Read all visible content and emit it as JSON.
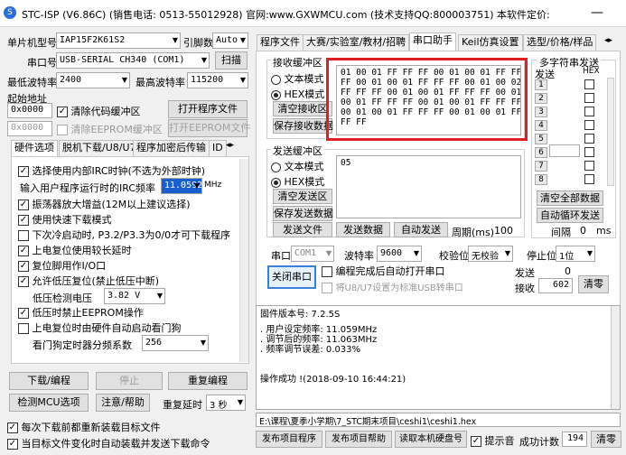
{
  "title": "STC-ISP (V6.86C) (销售电话: 0513-55012928) 官网:www.GXWMCU.com  (技术支持QQ:800003751) 本软件定价:",
  "left": {
    "mcu_model_label": "单片机型号",
    "mcu_model": "IAP15F2K61S2",
    "pin_label": "引脚数",
    "pin_value": "Auto",
    "port_label": "串口号",
    "port_value": "USB-SERIAL CH340 (COM1)",
    "scan_btn": "扫描",
    "min_baud_label": "最低波特率",
    "min_baud": "2400",
    "max_baud_label": "最高波特率",
    "max_baud": "115200",
    "start_addr_label": "起始地址",
    "addr1": "0x0000",
    "clear_code_label": "清除代码缓冲区",
    "open_prog_btn": "打开程序文件",
    "addr2": "0x0000",
    "clear_eeprom_label": "清除EEPROM缓冲区",
    "open_eeprom_btn": "打开EEPROM文件",
    "tabs": [
      "硬件选项",
      "脱机下载/U8/U7",
      "程序加密后传输",
      "ID"
    ],
    "opt_irc": "选择使用内部IRC时钟(不选为外部时钟)",
    "opt_freq_label": "输入用户程序运行时的IRC频率",
    "opt_freq_value": "11.0592",
    "opt_freq_unit": "MHz",
    "opt_amp": "振荡器放大增益(12M以上建议选择)",
    "opt_fast": "使用快速下载模式",
    "opt_cold": "下次冷启动时, P3.2/P3.3为0/0才可下载程序",
    "opt_reset_delay": "上电复位使用较长延时",
    "opt_reset_pin": "复位脚用作I/O口",
    "opt_lvr": "允许低压复位(禁止低压中断)",
    "opt_lv_label": "低压检测电压",
    "opt_lv_value": "3.82 V",
    "opt_eeprom": "低压时禁止EEPROM操作",
    "opt_wdt": "上电复位时由硬件自动启动看门狗",
    "opt_wdt_label": "看门狗定时器分频系数",
    "opt_wdt_value": "256",
    "download_btn": "下载/编程",
    "stop_btn": "停止",
    "reprog_btn": "重复编程",
    "check_btn": "检测MCU选项",
    "help_btn": "注意/帮助",
    "delay_label": "重复延时",
    "delay_value": "3 秒",
    "reload_label": "每次下载前都重新装载目标文件",
    "auto_label": "当目标文件变化时自动装载并发送下载命令"
  },
  "right": {
    "tabs": [
      "程序文件",
      "大赛/实验室/教材/招聘",
      "串口助手",
      "Keil仿真设置",
      "选型/价格/样品"
    ],
    "recv_title": "接收缓冲区",
    "text_mode": "文本模式",
    "hex_mode": "HEX模式",
    "clear_recv": "清空接收区",
    "save_recv": "保存接收数据",
    "recv_data": "01 00 01 FF FF FF 00 01 00 01 FF FF\nFF 00 01 00 01 FF FF FF 00 01 00 02\nFF FF FF 00 01 00 01 FF FF FF 00 01\n00 01 FF FF FF 00 01 00 01 FF FF FF\n00 01 00 01 FF FF FF 00 01 00 01 FF\nFF FF",
    "send_title": "发送缓冲区",
    "send_data": "05",
    "clear_send": "清空发送区",
    "save_send": "保存发送数据",
    "send_file": "发送文件",
    "send_data_btn": "发送数据",
    "auto_send": "自动发送",
    "period_label": "周期(ms)",
    "period_value": "100",
    "multi_title": "多字符串发送",
    "send_col": "发送",
    "hex_col": "HEX",
    "multi_rows": [
      "1",
      "2",
      "3",
      "4",
      "5",
      "6",
      "7",
      "8"
    ],
    "clear_all": "清空全部数据",
    "auto_loop": "自动循环发送",
    "interval_label": "间隔",
    "interval_value": "0",
    "interval_unit": "ms",
    "serial_label": "串口",
    "serial_value": "COM1",
    "baud_label": "波特率",
    "baud_value": "9600",
    "parity_label": "校验位",
    "parity_value": "无校验",
    "stop_label": "停止位",
    "stop_value": "1位",
    "close_port": "关闭串口",
    "auto_open": "编程完成后自动打开串口",
    "u8_label": "将U8/U7设置为标准USB转串口",
    "send_count_label": "发送",
    "send_count": "0",
    "recv_count_label": "接收",
    "recv_count": "602",
    "clear_count": "清零",
    "log_lines": [
      "固件版本号: 7.2.5S",
      "",
      ". 用户设定频率: 11.059MHz",
      ". 调节后的频率: 11.063MHz",
      ". 频率调节误差: 0.033%",
      "",
      "",
      "操作成功 !(2018-09-10 16:44:21)"
    ],
    "path": "E:\\课程\\夏季小学期\\7_STC期末项目\\ceshi1\\ceshi1.hex",
    "bottom_btns": [
      "发布项目程序",
      "发布项目帮助",
      "读取本机硬盘号"
    ],
    "beep_label": "提示音",
    "success_label": "成功计数",
    "success_count": "194",
    "clear_btn": "清零"
  }
}
